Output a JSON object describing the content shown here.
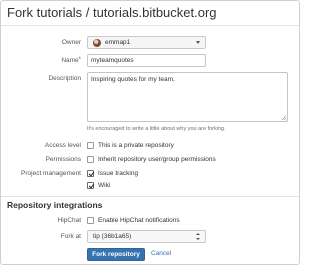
{
  "page": {
    "title": "Fork tutorials / tutorials.bitbucket.org"
  },
  "form": {
    "owner": {
      "label": "Owner",
      "value": "emmap1"
    },
    "name": {
      "label": "Name",
      "required_mark": "*",
      "value": "myteamquotes"
    },
    "description": {
      "label": "Description",
      "value": "Inspiring quotes for my team.",
      "hint": "It's encouraged to write a little about why you are forking."
    },
    "access_level": {
      "label": "Access level",
      "option": "This is a private repository",
      "checked": false
    },
    "permissions": {
      "label": "Permissions",
      "option": "Inherit repository user/group permissions",
      "checked": false
    },
    "project_management": {
      "label": "Project management",
      "options": [
        {
          "label": "Issue tracking",
          "checked": true
        },
        {
          "label": "Wiki",
          "checked": true
        }
      ]
    }
  },
  "integrations": {
    "heading": "Repository integrations",
    "hipchat": {
      "label": "HipChat",
      "option": "Enable HipChat notifications",
      "checked": false
    },
    "fork_at": {
      "label": "Fork at",
      "value": "tip (36b1a65)"
    }
  },
  "actions": {
    "submit_label": "Fork repository",
    "cancel_label": "Cancel"
  },
  "colors": {
    "primary": "#3572b0",
    "link": "#3572b0",
    "required": "#d04437"
  },
  "icons": {
    "owner_avatar": "avatar",
    "owner_caret": "chevron-down-icon",
    "fork_at_caret": "updown-icon"
  }
}
